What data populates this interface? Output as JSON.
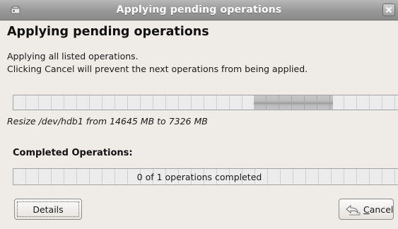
{
  "window": {
    "title": "Applying pending operations",
    "app_icon": "gparted-icon",
    "close_icon": "close-icon"
  },
  "content": {
    "heading": "Applying pending operations",
    "description_line1": "Applying all listed operations.",
    "description_line2": "Clicking Cancel will prevent the next operations from being applied.",
    "current_operation": "Resize /dev/hdb1 from 14645 MB to 7326 MB",
    "current_progress_state": "indeterminate",
    "completed_heading": "Completed Operations:",
    "completed_text": "0 of 1 operations completed",
    "completed_fraction": 0
  },
  "buttons": {
    "details_label": "Details",
    "cancel_prefix": "",
    "cancel_mnemonic": "C",
    "cancel_rest": "ancel",
    "cancel_icon": "undo-arrow-icon"
  },
  "colors": {
    "window_bg": "#efebe7",
    "titlebar": "#9a9a9a",
    "progress_chunk": "#b5b5b5"
  }
}
